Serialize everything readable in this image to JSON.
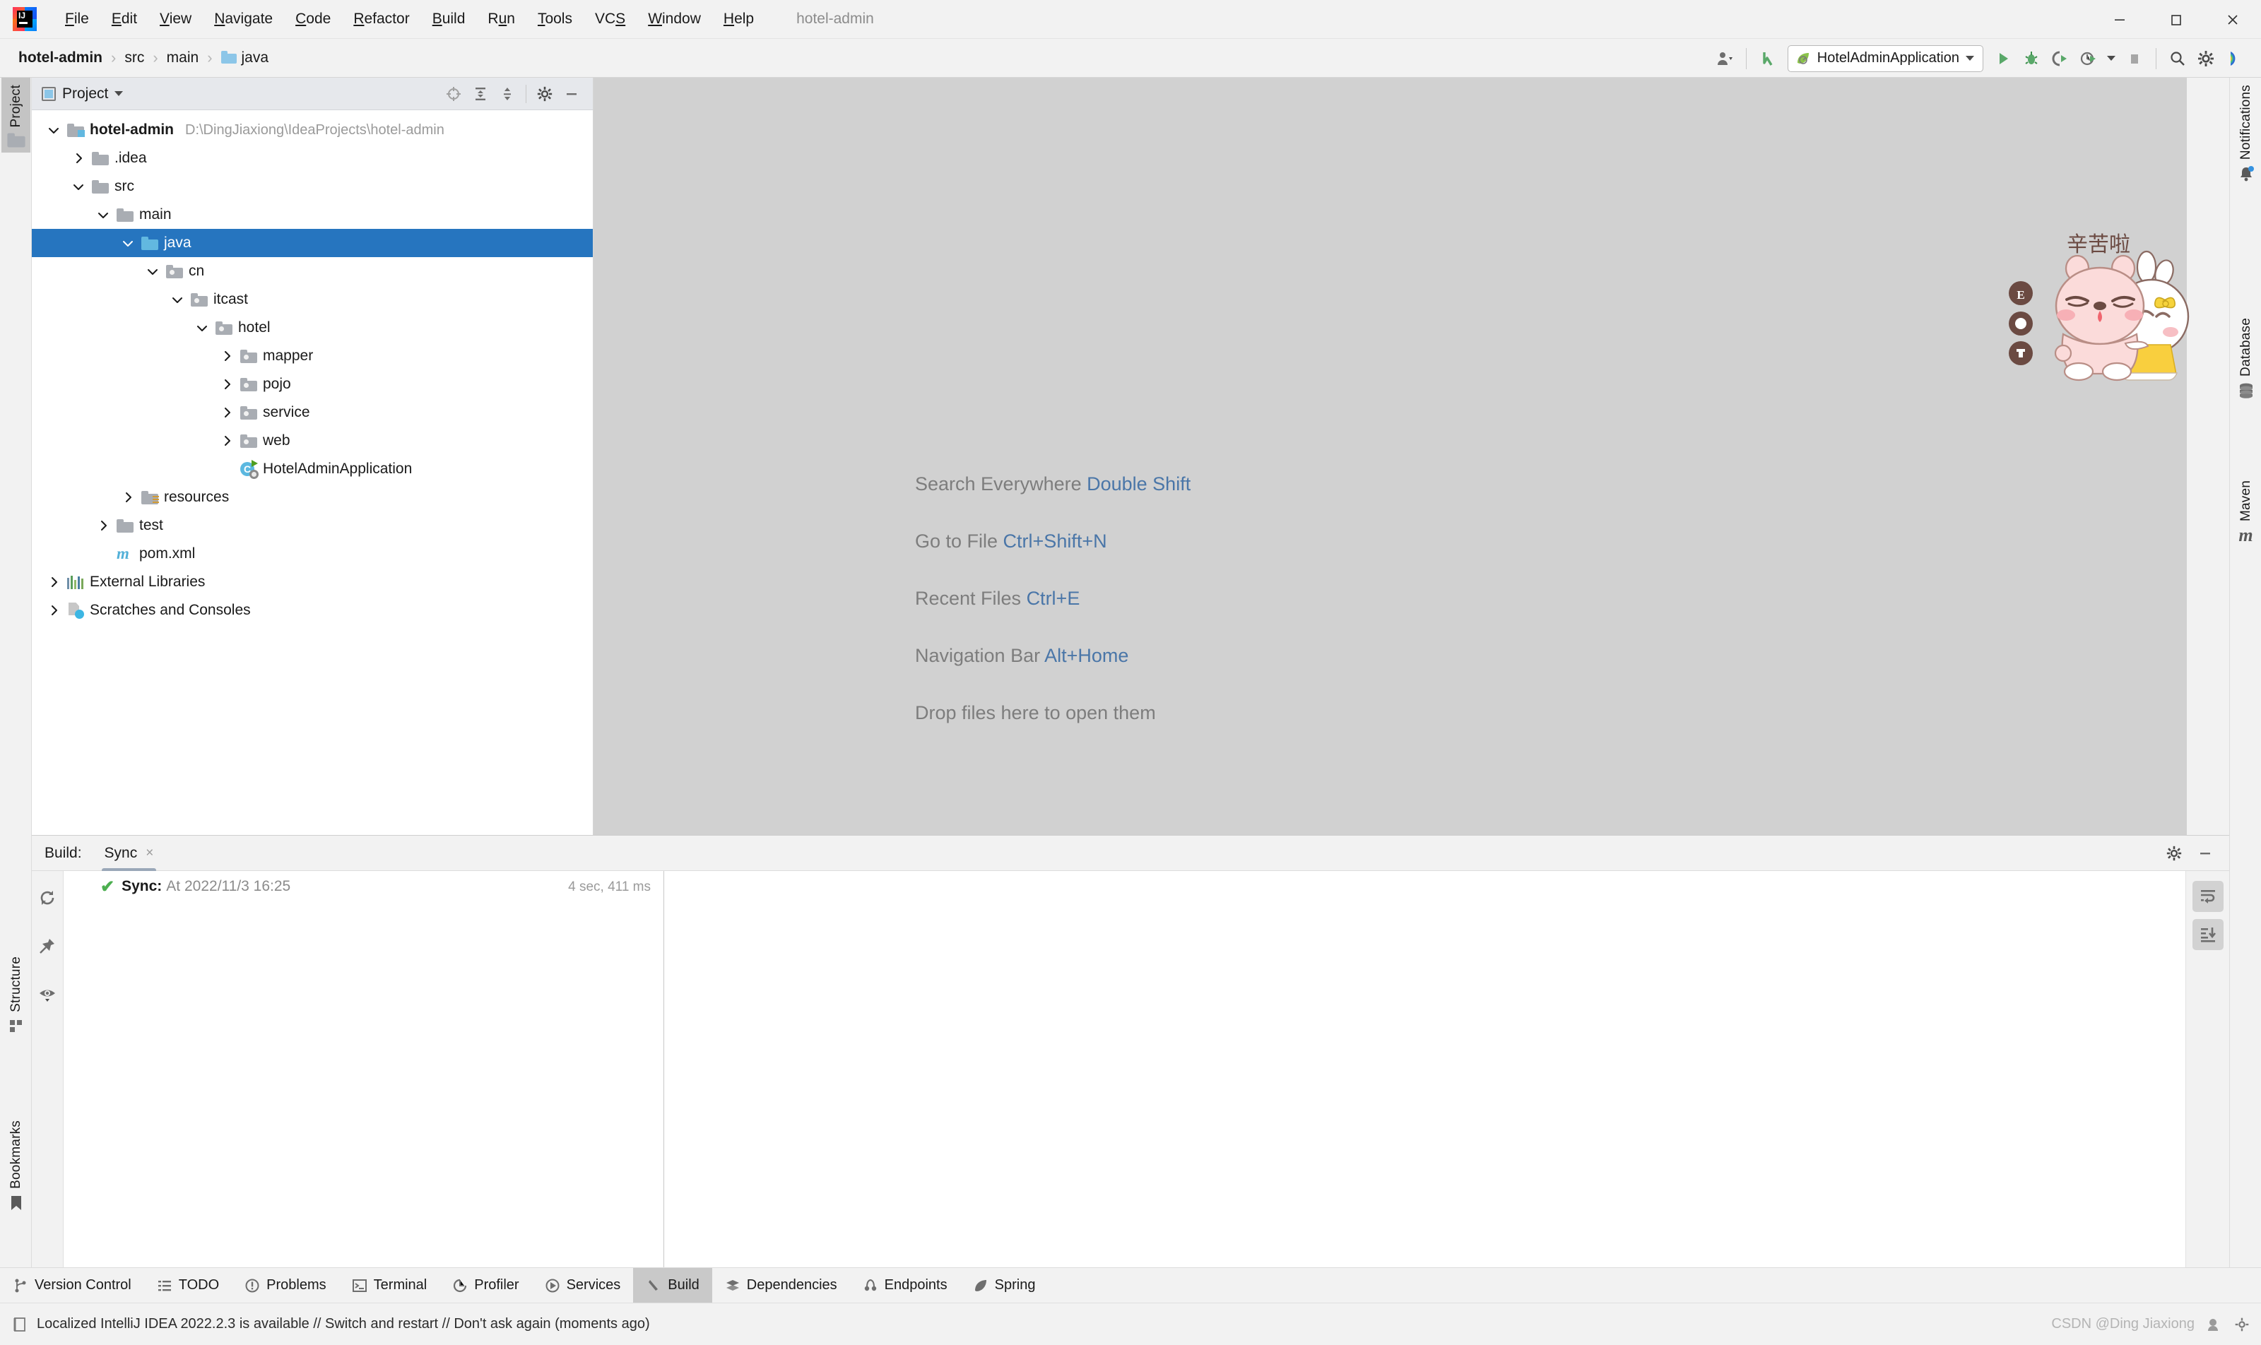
{
  "window": {
    "title": "hotel-admin",
    "minimize_label": "Minimize",
    "restore_label": "Restore",
    "close_label": "Close"
  },
  "menubar": {
    "items": [
      {
        "label": "File",
        "mnemonic": "F"
      },
      {
        "label": "Edit",
        "mnemonic": "E"
      },
      {
        "label": "View",
        "mnemonic": "V"
      },
      {
        "label": "Navigate",
        "mnemonic": "N"
      },
      {
        "label": "Code",
        "mnemonic": "C"
      },
      {
        "label": "Refactor",
        "mnemonic": "R"
      },
      {
        "label": "Build",
        "mnemonic": "B"
      },
      {
        "label": "Run",
        "mnemonic": "u"
      },
      {
        "label": "Tools",
        "mnemonic": "T"
      },
      {
        "label": "VCS",
        "mnemonic": "S"
      },
      {
        "label": "Window",
        "mnemonic": "W"
      },
      {
        "label": "Help",
        "mnemonic": "H"
      }
    ]
  },
  "navbar": {
    "breadcrumbs": [
      {
        "label": "hotel-admin",
        "bold": true,
        "icon": ""
      },
      {
        "label": "src",
        "bold": false,
        "icon": ""
      },
      {
        "label": "main",
        "bold": false,
        "icon": ""
      },
      {
        "label": "java",
        "bold": false,
        "icon": "folder-blue"
      }
    ],
    "separator": "›",
    "run_config": "HotelAdminApplication",
    "icons": {
      "account": "account-icon",
      "updates": "updates-arrow-icon",
      "run": "run-icon",
      "debug": "debug-icon",
      "run_with_coverage": "run-with-coverage-icon",
      "profiler": "profiler-icon",
      "stop": "stop-icon",
      "search": "search-icon",
      "settings": "gear-icon",
      "ide_assistant": "ide-assistant-icon"
    }
  },
  "left_stripe": {
    "top": [
      {
        "label": "Project",
        "icon": "project-folder-icon",
        "active": true
      }
    ],
    "bottom": [
      {
        "label": "Structure",
        "icon": "structure-icon",
        "active": false
      },
      {
        "label": "Bookmarks",
        "icon": "bookmark-icon",
        "active": false
      }
    ]
  },
  "right_stripe": {
    "items": [
      {
        "label": "Notifications",
        "icon": "bell-icon"
      },
      {
        "label": "Database",
        "icon": "database-icon"
      },
      {
        "label": "Maven",
        "icon": "maven-m-icon"
      }
    ]
  },
  "project_panel": {
    "tab_label": "Project",
    "actions": [
      {
        "name": "select-opened-file-icon",
        "label": "Select Opened File"
      },
      {
        "name": "expand-all-icon",
        "label": "Expand All"
      },
      {
        "name": "collapse-all-icon",
        "label": "Collapse All"
      },
      {
        "name": "gear-icon",
        "label": "Options"
      },
      {
        "name": "hide-icon",
        "label": "Hide"
      }
    ],
    "tree": [
      {
        "depth": 0,
        "label": "hotel-admin",
        "path": "D:\\DingJiaxiong\\IdeaProjects\\hotel-admin",
        "icon": "module-folder-icon",
        "arrow": "down",
        "bold": true,
        "selected": false
      },
      {
        "depth": 1,
        "label": ".idea",
        "path": "",
        "icon": "folder-gray-icon",
        "arrow": "right",
        "bold": false,
        "selected": false
      },
      {
        "depth": 1,
        "label": "src",
        "path": "",
        "icon": "folder-gray-icon",
        "arrow": "down",
        "bold": false,
        "selected": false
      },
      {
        "depth": 2,
        "label": "main",
        "path": "",
        "icon": "folder-gray-icon",
        "arrow": "down",
        "bold": false,
        "selected": false
      },
      {
        "depth": 3,
        "label": "java",
        "path": "",
        "icon": "folder-blue-icon",
        "arrow": "down",
        "bold": false,
        "selected": true
      },
      {
        "depth": 4,
        "label": "cn",
        "path": "",
        "icon": "package-icon",
        "arrow": "down",
        "bold": false,
        "selected": false
      },
      {
        "depth": 5,
        "label": "itcast",
        "path": "",
        "icon": "package-icon",
        "arrow": "down",
        "bold": false,
        "selected": false
      },
      {
        "depth": 6,
        "label": "hotel",
        "path": "",
        "icon": "package-icon",
        "arrow": "down",
        "bold": false,
        "selected": false
      },
      {
        "depth": 7,
        "label": "mapper",
        "path": "",
        "icon": "package-icon",
        "arrow": "right",
        "bold": false,
        "selected": false
      },
      {
        "depth": 7,
        "label": "pojo",
        "path": "",
        "icon": "package-icon",
        "arrow": "right",
        "bold": false,
        "selected": false
      },
      {
        "depth": 7,
        "label": "service",
        "path": "",
        "icon": "package-icon",
        "arrow": "right",
        "bold": false,
        "selected": false
      },
      {
        "depth": 7,
        "label": "web",
        "path": "",
        "icon": "package-icon",
        "arrow": "right",
        "bold": false,
        "selected": false
      },
      {
        "depth": 7,
        "label": "HotelAdminApplication",
        "path": "",
        "icon": "java-class-runnable-icon",
        "arrow": "none",
        "bold": false,
        "selected": false
      },
      {
        "depth": 3,
        "label": "resources",
        "path": "",
        "icon": "resources-folder-icon",
        "arrow": "right",
        "bold": false,
        "selected": false
      },
      {
        "depth": 2,
        "label": "test",
        "path": "",
        "icon": "folder-gray-icon",
        "arrow": "right",
        "bold": false,
        "selected": false
      },
      {
        "depth": 2,
        "label": "pom.xml",
        "path": "",
        "icon": "maven-pom-icon",
        "arrow": "none",
        "bold": false,
        "selected": false
      },
      {
        "depth": 0,
        "label": "External Libraries",
        "path": "",
        "icon": "libraries-icon",
        "arrow": "right",
        "bold": false,
        "selected": false
      },
      {
        "depth": 0,
        "label": "Scratches and Consoles",
        "path": "",
        "icon": "scratches-icon",
        "arrow": "right",
        "bold": false,
        "selected": false
      }
    ]
  },
  "editor": {
    "hints": [
      {
        "text": "Search Everywhere ",
        "key": "Double Shift"
      },
      {
        "text": "Go to File ",
        "key": "Ctrl+Shift+N"
      },
      {
        "text": "Recent Files ",
        "key": "Ctrl+E"
      },
      {
        "text": "Navigation Bar ",
        "key": "Alt+Home"
      },
      {
        "text": "Drop files here to open them",
        "key": ""
      }
    ],
    "sticker_caption": "辛苦啦"
  },
  "build_panel": {
    "title": "Build:",
    "tab_label": "Sync",
    "tab_close": "×",
    "node_label": "Sync:",
    "node_detail": "At 2022/11/3 16:25",
    "duration": "4 sec, 411 ms",
    "status_icon": "✔",
    "side_actions": [
      {
        "name": "rerun-icon",
        "label": "Rerun"
      },
      {
        "name": "pin-icon",
        "label": "Pin Tab"
      },
      {
        "name": "eye-icon",
        "label": "Show Options"
      }
    ],
    "head_actions": [
      {
        "name": "gear-icon",
        "label": "Settings"
      },
      {
        "name": "hide-icon",
        "label": "Hide"
      }
    ],
    "rail_actions": [
      {
        "name": "soft-wrap-icon",
        "label": "Soft-Wrap"
      },
      {
        "name": "scroll-to-end-icon",
        "label": "Scroll to End"
      }
    ]
  },
  "bottom_stripe": {
    "items": [
      {
        "label": "Version Control",
        "icon": "branch-icon",
        "active": false
      },
      {
        "label": "TODO",
        "icon": "todo-list-icon",
        "active": false
      },
      {
        "label": "Problems",
        "icon": "problems-icon",
        "active": false
      },
      {
        "label": "Terminal",
        "icon": "terminal-icon",
        "active": false
      },
      {
        "label": "Profiler",
        "icon": "profiler-icon",
        "active": false
      },
      {
        "label": "Services",
        "icon": "services-icon",
        "active": false
      },
      {
        "label": "Build",
        "icon": "build-hammer-icon",
        "active": true
      },
      {
        "label": "Dependencies",
        "icon": "dependencies-icon",
        "active": false
      },
      {
        "label": "Endpoints",
        "icon": "endpoints-icon",
        "active": false
      },
      {
        "label": "Spring",
        "icon": "spring-leaf-icon",
        "active": false
      }
    ]
  },
  "status_bar": {
    "message": "Localized IntelliJ IDEA 2022.2.3 is available // Switch and restart // Don't ask again (moments ago)",
    "icon": "notification-icon",
    "watermark": "CSDN @Ding Jiaxiong",
    "right_icons": [
      {
        "name": "assistant-icon"
      },
      {
        "name": "gear-icon"
      }
    ]
  },
  "colors": {
    "selection_blue": "#2675bf",
    "link_blue": "#4a76a8",
    "editor_bg": "#d1d1d1",
    "panel_bg": "#f2f2f2",
    "tree_bg": "#ffffff",
    "success_green": "#4caf50",
    "folder_blue": "#62b8e0",
    "folder_gray": "#a9adb3"
  }
}
